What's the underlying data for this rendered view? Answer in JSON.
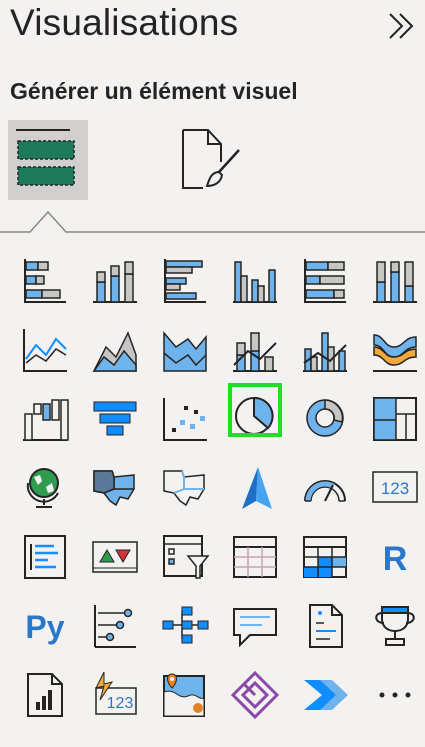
{
  "pane": {
    "title": "Visualisations",
    "subtitle": "Générer un élément visuel"
  },
  "colors": {
    "accent_blue": "#118dff",
    "light_blue": "#6fb3ed",
    "stroke": "#252423",
    "selected_outline": "#1fe01f",
    "tab_active_bg": "#d2d0ce"
  },
  "tabs": [
    {
      "name": "build-visual-tab",
      "icon": "build-visual-icon",
      "active": true
    },
    {
      "name": "format-visual-tab",
      "icon": "format-paintbrush-icon",
      "active": false
    }
  ],
  "visuals": [
    {
      "icon": "stacked-bar-chart-icon"
    },
    {
      "icon": "stacked-column-chart-icon"
    },
    {
      "icon": "clustered-bar-chart-icon"
    },
    {
      "icon": "clustered-column-chart-icon"
    },
    {
      "icon": "100-percent-stacked-bar-chart-icon"
    },
    {
      "icon": "100-percent-stacked-column-chart-icon"
    },
    {
      "icon": "line-chart-icon"
    },
    {
      "icon": "area-chart-icon"
    },
    {
      "icon": "stacked-area-chart-icon"
    },
    {
      "icon": "line-and-stacked-column-chart-icon"
    },
    {
      "icon": "line-and-clustered-column-chart-icon"
    },
    {
      "icon": "ribbon-chart-icon"
    },
    {
      "icon": "waterfall-chart-icon"
    },
    {
      "icon": "funnel-chart-icon"
    },
    {
      "icon": "scatter-chart-icon"
    },
    {
      "icon": "pie-chart-icon",
      "selected": true
    },
    {
      "icon": "donut-chart-icon"
    },
    {
      "icon": "treemap-icon"
    },
    {
      "icon": "map-icon"
    },
    {
      "icon": "filled-map-icon"
    },
    {
      "icon": "shape-map-icon"
    },
    {
      "icon": "azure-map-icon"
    },
    {
      "icon": "gauge-icon"
    },
    {
      "icon": "card-icon",
      "text": "123"
    },
    {
      "icon": "multi-row-card-icon"
    },
    {
      "icon": "kpi-icon"
    },
    {
      "icon": "slicer-icon"
    },
    {
      "icon": "table-icon"
    },
    {
      "icon": "matrix-icon"
    },
    {
      "icon": "r-script-visual-icon",
      "text": "R"
    },
    {
      "icon": "python-visual-icon",
      "text": "Py"
    },
    {
      "icon": "key-influencers-icon"
    },
    {
      "icon": "decomposition-tree-icon"
    },
    {
      "icon": "qa-icon"
    },
    {
      "icon": "smart-narrative-icon"
    },
    {
      "icon": "metrics-icon"
    },
    {
      "icon": "paginated-report-icon"
    },
    {
      "icon": "power-apps-card-icon",
      "text": "123"
    },
    {
      "icon": "arcgis-map-icon"
    },
    {
      "icon": "power-apps-icon"
    },
    {
      "icon": "power-automate-icon"
    },
    {
      "icon": "more-visuals-icon",
      "text": "···"
    }
  ]
}
